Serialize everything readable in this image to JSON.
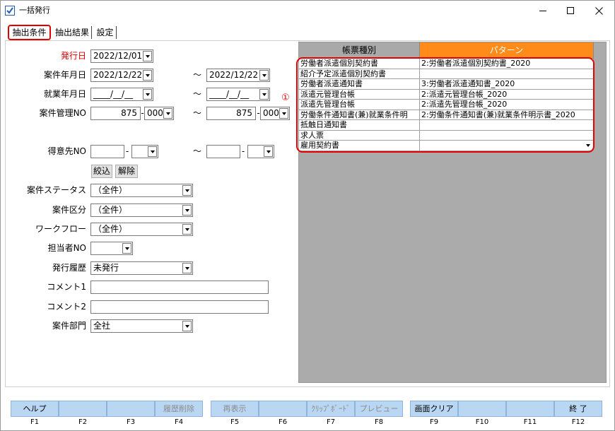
{
  "window": {
    "title": "一括発行"
  },
  "tabs": [
    {
      "label": "抽出条件",
      "selected": true
    },
    {
      "label": "抽出結果",
      "selected": false
    },
    {
      "label": "設定",
      "selected": false
    }
  ],
  "form": {
    "range_separator": "～",
    "number_separator": "-",
    "issue_date": {
      "label": "発行日",
      "value": "2022/12/01"
    },
    "case_date": {
      "label": "案件年月日",
      "from": "2022/12/22",
      "to": "2022/12/22"
    },
    "work_date": {
      "label": "就業年月日",
      "from": "____/__/__",
      "to": "____/__/__"
    },
    "case_no": {
      "label": "案件管理NO",
      "from_number": "875",
      "from_branch": "000",
      "to_number": "875",
      "to_branch": "000"
    },
    "customer_no": {
      "label": "得意先NO",
      "from_number": "",
      "from_branch": "",
      "to_number": "",
      "to_branch": ""
    },
    "filter_button": "絞込",
    "clear_button": "解除",
    "case_status": {
      "label": "案件ステータス",
      "value": "（全件）"
    },
    "case_category": {
      "label": "案件区分",
      "value": "（全件）"
    },
    "workflow": {
      "label": "ワークフロー",
      "value": "（全件）"
    },
    "staff_no": {
      "label": "担当者NO",
      "value": ""
    },
    "issue_history": {
      "label": "発行履歴",
      "value": "未発行"
    },
    "comment1": {
      "label": "コメント1",
      "value": ""
    },
    "comment2": {
      "label": "コメント2",
      "value": ""
    },
    "case_department": {
      "label": "案件部門",
      "value": "全社"
    }
  },
  "form_grid": {
    "headers": {
      "type": "帳票種別",
      "pattern": "パターン"
    },
    "rows": [
      {
        "type": "労働者派遣個別契約書",
        "pattern": "2:労働者派遣個別契約書_2020"
      },
      {
        "type": "紹介予定派遣個別契約書",
        "pattern": ""
      },
      {
        "type": "労働者派遣通知書",
        "pattern": "3:労働者派遣通知書_2020"
      },
      {
        "type": "派遣元管理台帳",
        "pattern": "2:派遣元管理台帳_2020"
      },
      {
        "type": "派遣先管理台帳",
        "pattern": "2:派遣先管理台帳_2020"
      },
      {
        "type": "労働条件通知書(兼)就業条件明",
        "pattern": "2:労働条件通知書(兼)就業条件明示書_2020"
      },
      {
        "type": "抵触日通知書",
        "pattern": ""
      },
      {
        "type": "求人票",
        "pattern": ""
      },
      {
        "type": "雇用契約書",
        "pattern": ""
      }
    ]
  },
  "annotation": "①",
  "function_keys": [
    {
      "key": "F1",
      "label": "ヘルプ",
      "disabled": false
    },
    {
      "key": "F2",
      "label": "",
      "disabled": false
    },
    {
      "key": "F3",
      "label": "",
      "disabled": false
    },
    {
      "key": "F4",
      "label": "履歴削除",
      "disabled": true
    },
    {
      "key": "F5",
      "label": "再表示",
      "disabled": true
    },
    {
      "key": "F6",
      "label": "",
      "disabled": false
    },
    {
      "key": "F7",
      "label": "ｸﾘｯﾌﾟﾎﾞｰﾄﾞ",
      "disabled": true
    },
    {
      "key": "F8",
      "label": "プレビュー",
      "disabled": true
    },
    {
      "key": "F9",
      "label": "画面クリア",
      "disabled": false
    },
    {
      "key": "F10",
      "label": "",
      "disabled": false
    },
    {
      "key": "F11",
      "label": "",
      "disabled": false
    },
    {
      "key": "F12",
      "label": "終 了",
      "disabled": false
    }
  ],
  "icons": {
    "app": "app-icon",
    "dropdown": "chevron-down-icon",
    "minimize": "minimize-icon",
    "maximize": "maximize-icon",
    "close": "close-icon"
  },
  "colors": {
    "pattern_header": "#FF8C1A",
    "highlight_red": "#E00000",
    "function_button": "#B9D6F2",
    "grid_background": "#ABABAB"
  }
}
